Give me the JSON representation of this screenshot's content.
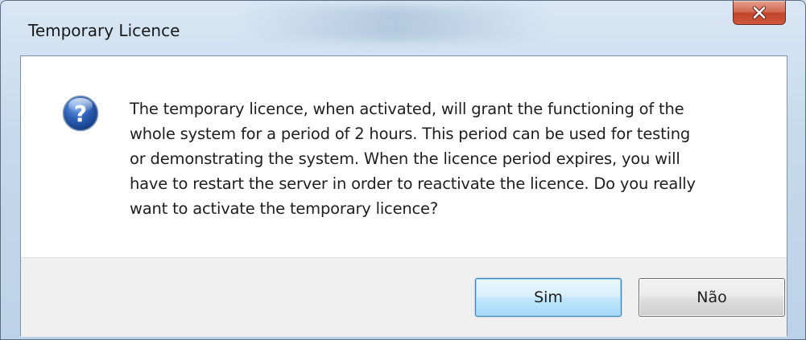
{
  "window": {
    "title": "Temporary Licence"
  },
  "dialog": {
    "icon": "question-icon",
    "message_lines": [
      "The temporary licence, when activated, will grant the functioning of the",
      "whole system for a period of 2 hours. This period can be used for testing",
      "or demonstrating the system. When the licence period expires, you will",
      "have to restart the server in order to reactivate the licence. Do you really",
      "want to activate the temporary licence?"
    ]
  },
  "buttons": {
    "yes_label": "Sim",
    "no_label": "Não"
  },
  "colors": {
    "frame": "#c6d9ec",
    "close_button": "#c0442b",
    "icon_blue": "#2c5fb3",
    "default_button_border": "#3c7fb1"
  }
}
